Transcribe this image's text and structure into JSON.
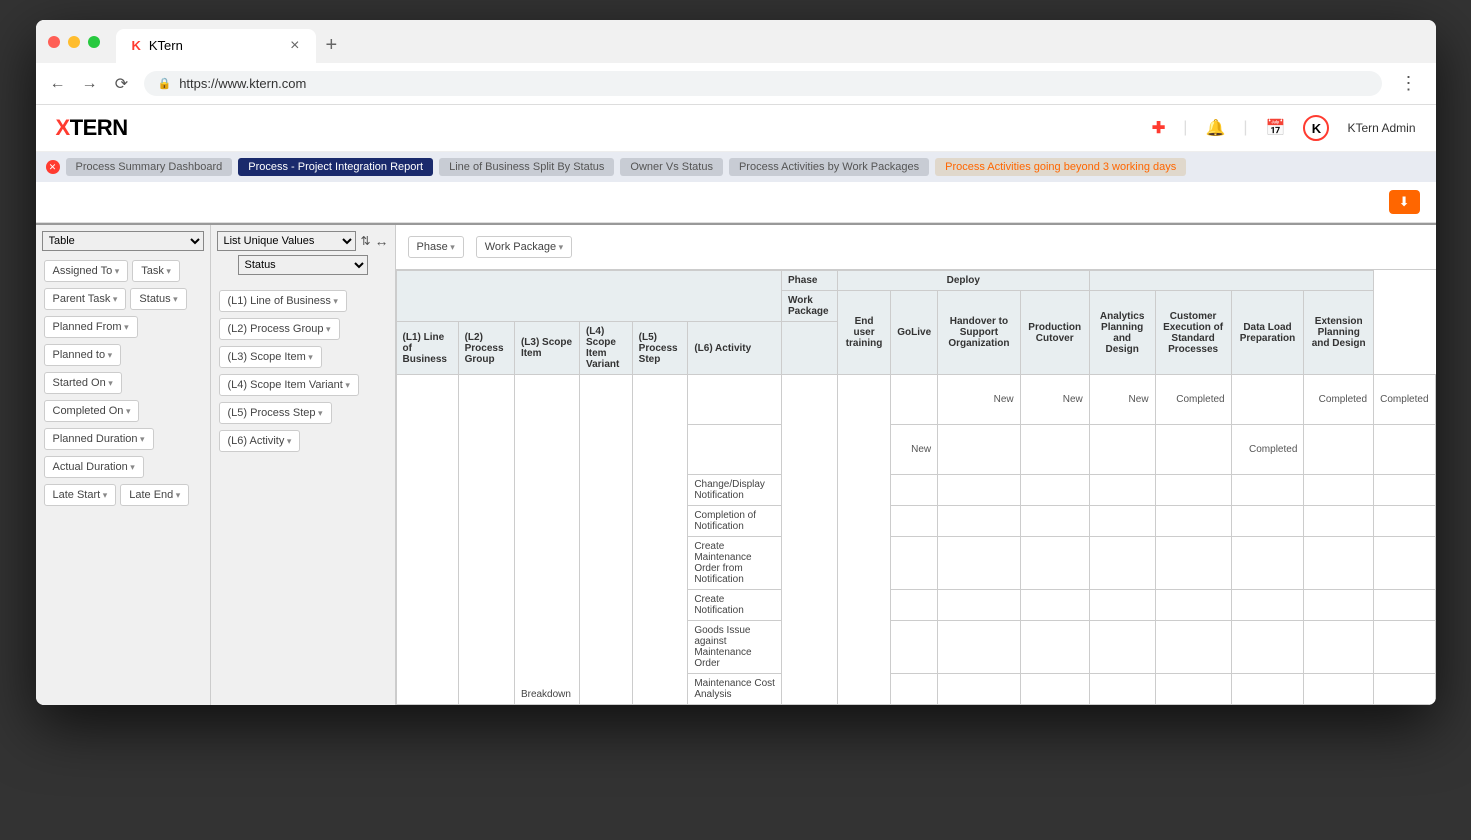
{
  "browser": {
    "tab_title": "KTern",
    "url": "https://www.ktern.com"
  },
  "app": {
    "logo_prefix": "X",
    "logo_text": "TERN",
    "user_name": "KTern Admin"
  },
  "nav_tabs": [
    "Process Summary Dashboard",
    "Process - Project Integration Report",
    "Line of Business Split By Status",
    "Owner Vs Status",
    "Process Activities by Work Packages",
    "Process Activities going beyond 3 working days"
  ],
  "left_panel": {
    "renderer": "Table",
    "fields": [
      "Assigned To",
      "Task",
      "Parent Task",
      "Status",
      "Planned From",
      "Planned to",
      "Started On",
      "Completed On",
      "Planned Duration",
      "Actual Duration",
      "Late Start",
      "Late End"
    ]
  },
  "mid_panel": {
    "aggregator": "List Unique Values",
    "attribute": "Status",
    "rows": [
      "(L1) Line of Business",
      "(L2) Process Group",
      "(L3) Scope Item",
      "(L4) Scope Item Variant",
      "(L5) Process Step",
      "(L6) Activity"
    ]
  },
  "col_axis": [
    "Phase",
    "Work Package"
  ],
  "pivot": {
    "row_headers": [
      "(L1) Line of Business",
      "(L2) Process Group",
      "(L3) Scope Item",
      "(L4) Scope Item Variant",
      "(L5) Process Step",
      "(L6) Activity"
    ],
    "corner_labels": {
      "phase": "Phase",
      "wp": "Work Package"
    },
    "phase_group": "Deploy",
    "wp_cols": [
      "End user training",
      "GoLive",
      "Handover to Support Organization",
      "Production Cutover",
      "Analytics Planning and Design",
      "Customer Execution of Standard Processes",
      "Data Load Preparation",
      "Extension Planning and Design"
    ],
    "data_rows": [
      {
        "steps": "",
        "vals": [
          "",
          "New",
          "New",
          "New",
          "Completed",
          "",
          "Completed",
          "Completed"
        ]
      },
      {
        "steps": "",
        "vals": [
          "New",
          "",
          "",
          "",
          "",
          "Completed",
          "",
          ""
        ]
      },
      {
        "steps": "Change/Display Notification",
        "vals": [
          "",
          "",
          "",
          "",
          "",
          "",
          "",
          ""
        ]
      },
      {
        "steps": "Completion of Notification",
        "vals": [
          "",
          "",
          "",
          "",
          "",
          "",
          "",
          ""
        ]
      },
      {
        "steps": "Create Maintenance Order from Notification",
        "vals": [
          "",
          "",
          "",
          "",
          "",
          "",
          "",
          ""
        ]
      },
      {
        "steps": "Create Notification",
        "vals": [
          "",
          "",
          "",
          "",
          "",
          "",
          "",
          ""
        ]
      },
      {
        "steps": "Goods Issue against Maintenance Order",
        "vals": [
          "",
          "",
          "",
          "",
          "",
          "",
          "",
          ""
        ]
      },
      {
        "steps": "Maintenance Cost Analysis",
        "vals": [
          "",
          "",
          "",
          "",
          "",
          "",
          "",
          ""
        ]
      }
    ],
    "l3_label": "Breakdown"
  }
}
